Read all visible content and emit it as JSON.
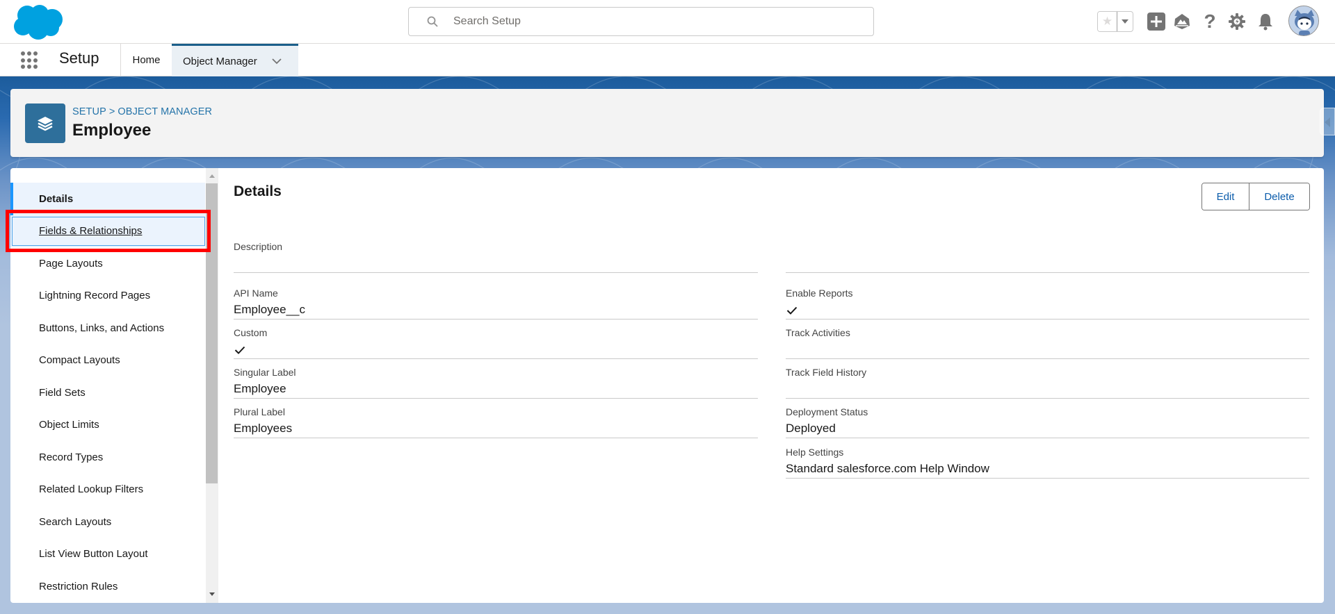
{
  "header": {
    "search_placeholder": "Search Setup",
    "icons": [
      "salesforce-logo",
      "favorite-star-icon",
      "favorites-dropdown-icon",
      "add-icon",
      "trailhead-icon",
      "help-icon",
      "setup-gear-icon",
      "notification-bell-icon",
      "user-avatar"
    ]
  },
  "nav": {
    "app_name": "Setup",
    "tabs": [
      {
        "label": "Home",
        "active": false
      },
      {
        "label": "Object Manager",
        "active": true
      }
    ]
  },
  "page_header": {
    "breadcrumb": [
      "SETUP",
      "OBJECT MANAGER"
    ],
    "breadcrumb_separator": ">",
    "title": "Employee",
    "icon": "layers-icon"
  },
  "sidebar": {
    "items": [
      {
        "label": "Details",
        "state": "active"
      },
      {
        "label": "Fields & Relationships",
        "state": "focused"
      },
      {
        "label": "Page Layouts"
      },
      {
        "label": "Lightning Record Pages"
      },
      {
        "label": "Buttons, Links, and Actions"
      },
      {
        "label": "Compact Layouts"
      },
      {
        "label": "Field Sets"
      },
      {
        "label": "Object Limits"
      },
      {
        "label": "Record Types"
      },
      {
        "label": "Related Lookup Filters"
      },
      {
        "label": "Search Layouts"
      },
      {
        "label": "List View Button Layout"
      },
      {
        "label": "Restriction Rules"
      }
    ]
  },
  "content": {
    "title": "Details",
    "buttons": {
      "edit": "Edit",
      "delete": "Delete"
    },
    "left_fields": [
      {
        "label": "Description",
        "value": ""
      },
      {
        "label": "API Name",
        "value": "Employee__c"
      },
      {
        "label": "Custom",
        "value": "",
        "checked": true
      },
      {
        "label": "Singular Label",
        "value": "Employee"
      },
      {
        "label": "Plural Label",
        "value": "Employees"
      }
    ],
    "right_fields": [
      {
        "label": "",
        "value": ""
      },
      {
        "label": "Enable Reports",
        "value": "",
        "checked": true
      },
      {
        "label": "Track Activities",
        "value": ""
      },
      {
        "label": "Track Field History",
        "value": ""
      },
      {
        "label": "Deployment Status",
        "value": "Deployed"
      },
      {
        "label": "Help Settings",
        "value": "Standard salesforce.com Help Window"
      }
    ]
  },
  "colors": {
    "brand_blue": "#00a1e0",
    "link_blue": "#0b5cab",
    "object_icon_bg": "#2e6f9b",
    "active_tab_border": "#1b5f8a",
    "highlight_red": "#ff0000"
  }
}
